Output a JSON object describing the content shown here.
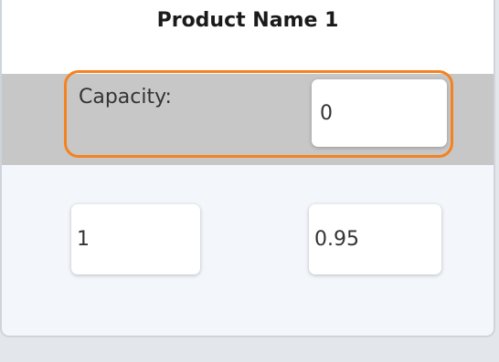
{
  "product": {
    "name": "Product Name 1"
  },
  "capacity": {
    "label": "Capacity:",
    "value": "0"
  },
  "fields": {
    "left_value": "1",
    "right_value": "0.95"
  },
  "colors": {
    "highlight": "#f5821f",
    "capacity_band": "#c7c7c7"
  }
}
